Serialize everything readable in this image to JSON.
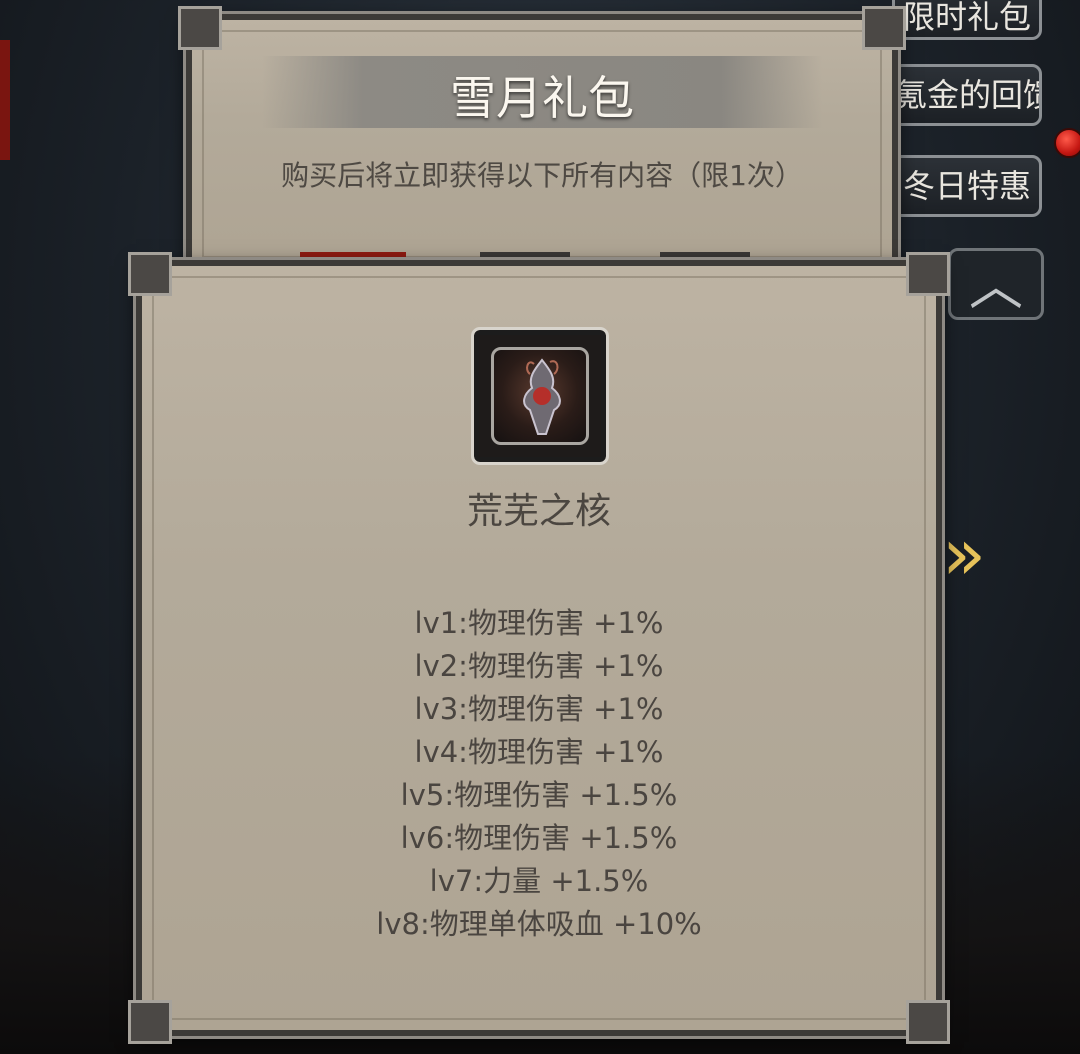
{
  "side_menu": [
    {
      "label": "限时礼包"
    },
    {
      "label": "氪金的回馈"
    },
    {
      "label": "冬日特惠"
    }
  ],
  "pack": {
    "title": "雪月礼包",
    "subtitle": "购买后将立即获得以下所有内容（限1次）"
  },
  "item": {
    "icon": "core-relic-icon",
    "name": "荒芜之核",
    "attributes": [
      "lv1:物理伤害 +1%",
      "lv2:物理伤害 +1%",
      "lv3:物理伤害 +1%",
      "lv4:物理伤害 +1%",
      "lv5:物理伤害 +1.5%",
      "lv6:物理伤害 +1.5%",
      "lv7:力量 +1.5%",
      "lv8:物理单体吸血 +10%"
    ]
  },
  "colors": {
    "panel": "#b7ad9d",
    "accent_gold": "#e7c35a",
    "notify_red": "#c51712"
  }
}
